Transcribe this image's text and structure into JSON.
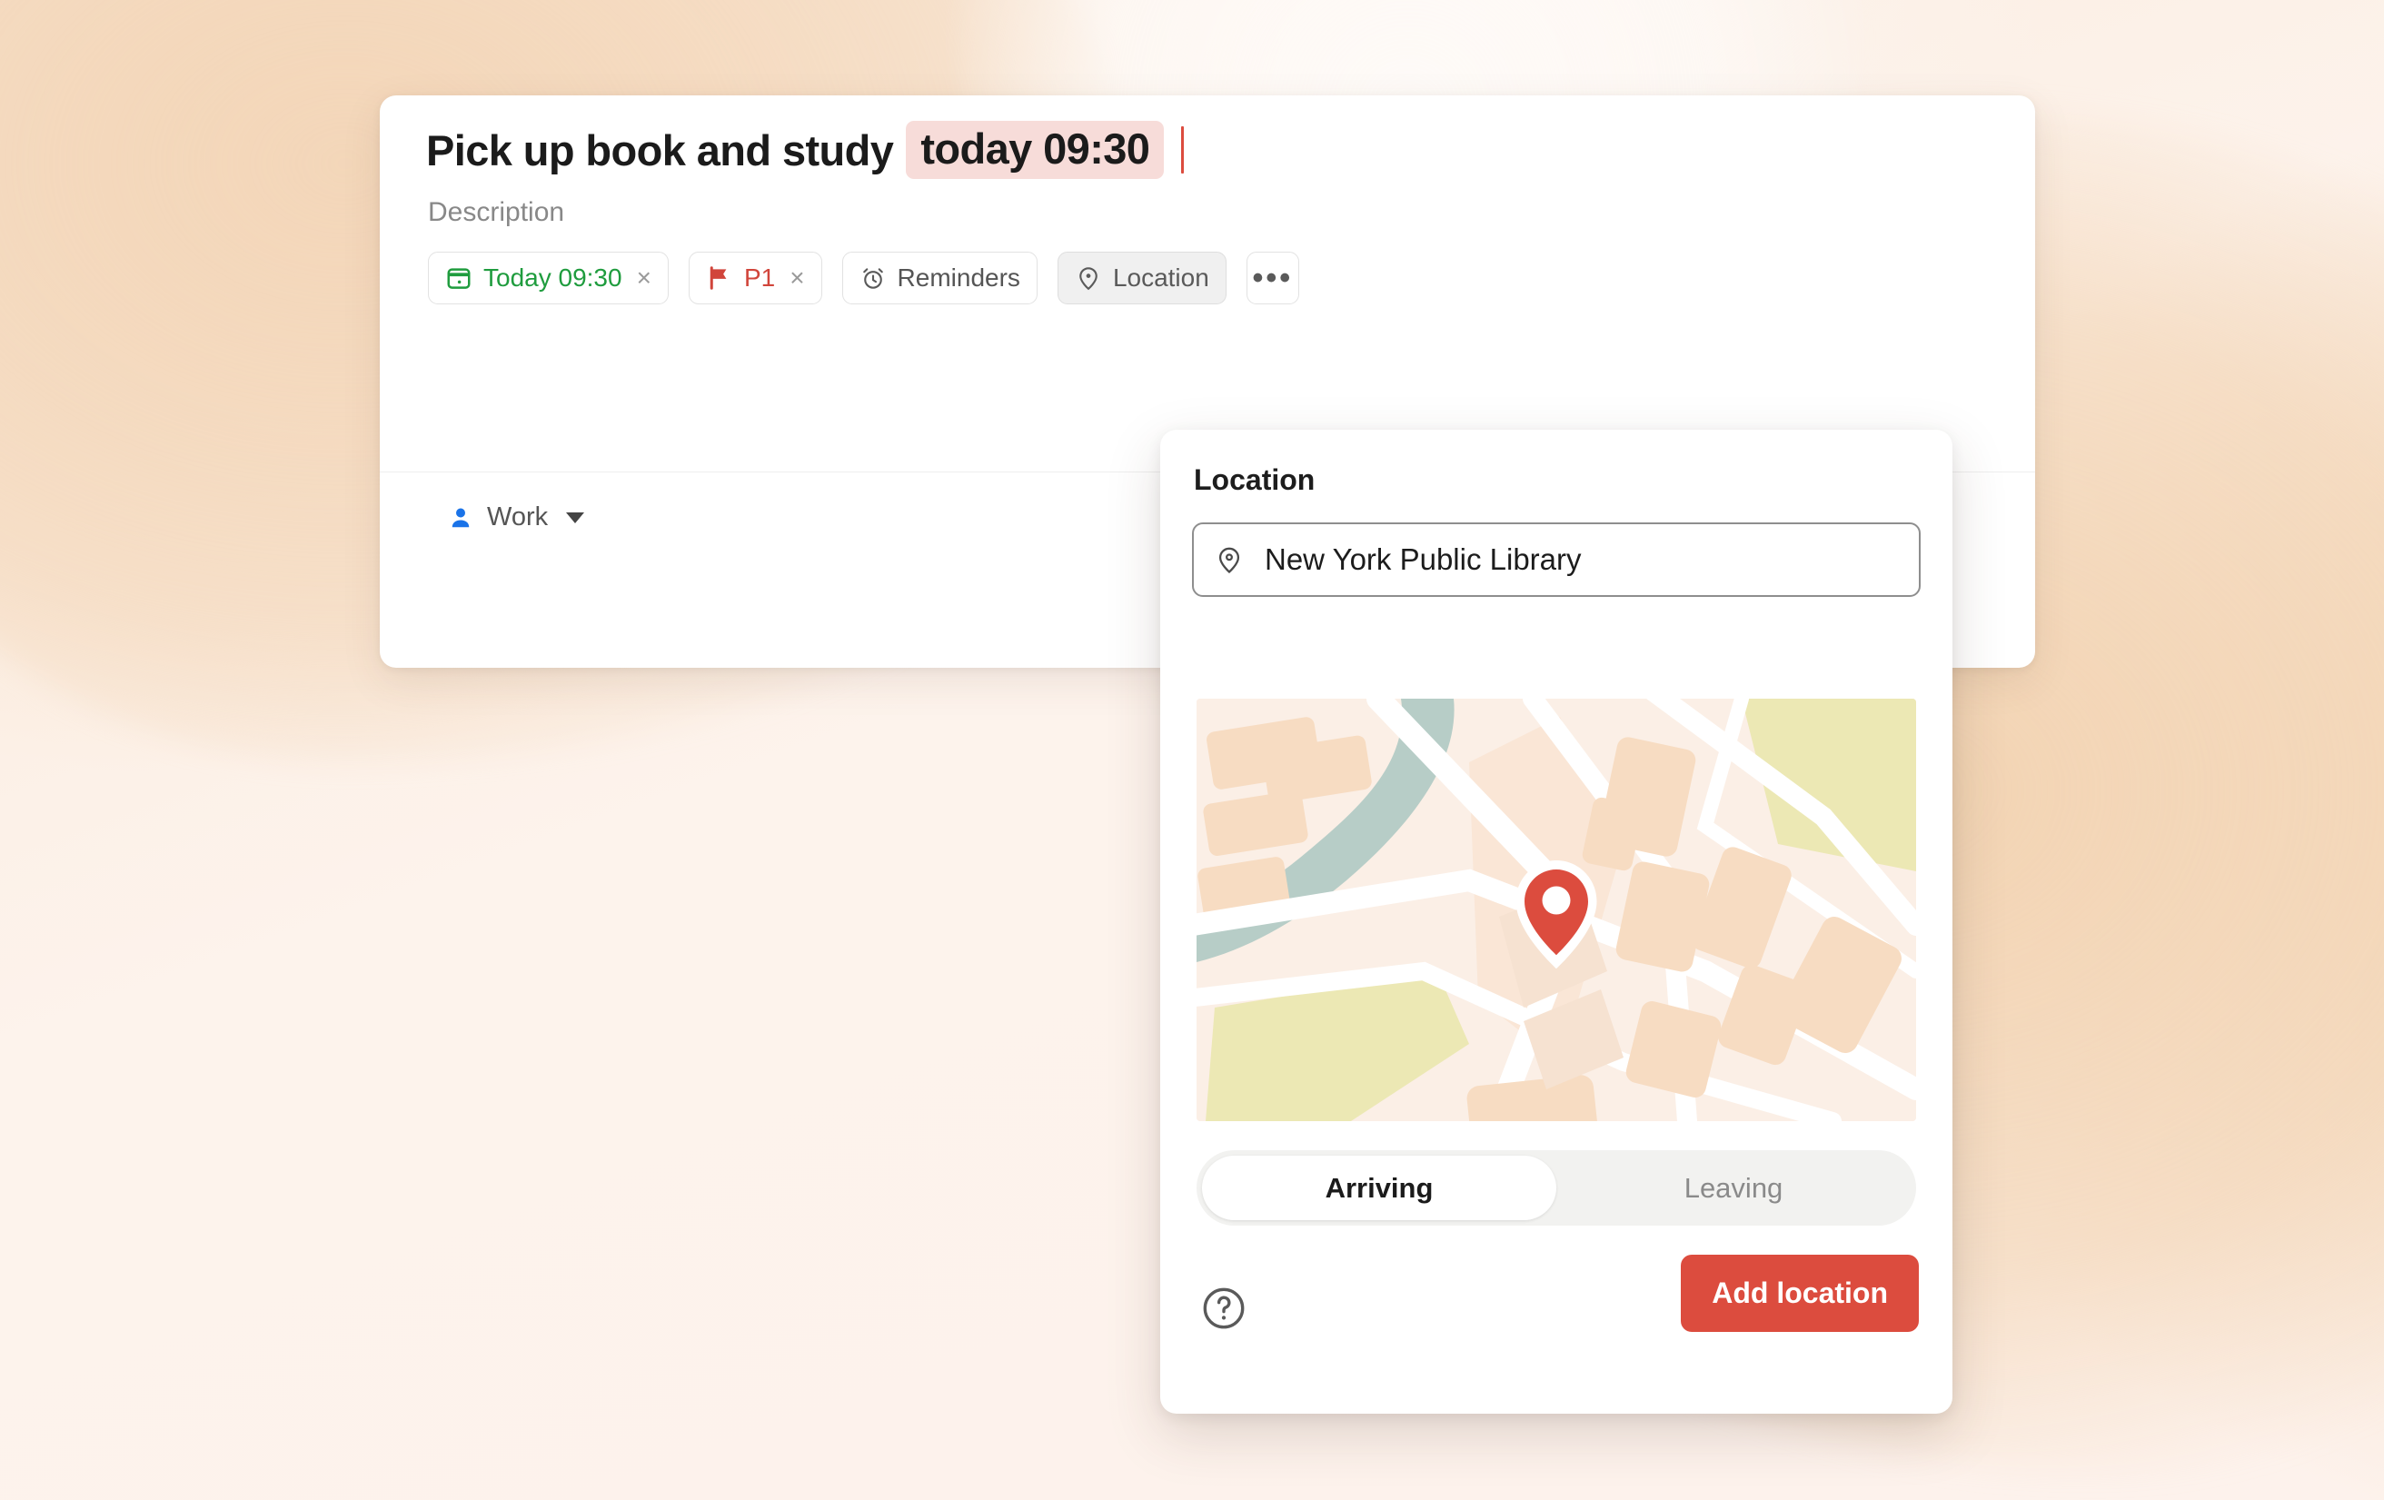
{
  "background": {
    "base_color": "#FDF3EC",
    "accent_color": "#F3D6B9"
  },
  "task_card": {
    "title_plain": "Pick up book and study",
    "title_date_token": "today 09:30",
    "description_placeholder": "Description",
    "caret_color": "#DC4C3E",
    "date_token_bg": "#F7DCD9",
    "chips": [
      {
        "id": "date",
        "icon": "calendar-icon",
        "label": "Today 09:30",
        "label_color": "#1F9C3E",
        "removable": true,
        "remove_label": "×",
        "active": false
      },
      {
        "id": "priority",
        "icon": "flag-icon",
        "label": "P1",
        "label_color": "#D1453B",
        "removable": true,
        "remove_label": "×",
        "active": false
      },
      {
        "id": "reminders",
        "icon": "alarm-clock-icon",
        "label": "Reminders",
        "label_color": "#555555",
        "removable": false,
        "active": false
      },
      {
        "id": "location",
        "icon": "map-pin-icon",
        "label": "Location",
        "label_color": "#5A5A5A",
        "removable": false,
        "active": true
      }
    ],
    "more_button_label": "•••",
    "assignee": {
      "icon": "person-icon",
      "label": "Work",
      "icon_color": "#1A73E8"
    }
  },
  "location_popup": {
    "title": "Location",
    "search": {
      "icon": "map-pin-outline-icon",
      "value": "New York Public Library",
      "placeholder": "Add location"
    },
    "map": {
      "pin_color": "#DC4C3E",
      "land_color": "#FBEFE6",
      "block_color": "#F7DCC2",
      "park_color": "#ECE8B4",
      "water_color": "#B7CDC7",
      "road_color": "#FFFFFF"
    },
    "segments": [
      {
        "label": "Arriving",
        "selected": true
      },
      {
        "label": "Leaving",
        "selected": false
      }
    ],
    "help_icon": "help-circle-icon",
    "primary_button": {
      "label": "Add location",
      "color": "#DC4C3E"
    }
  }
}
